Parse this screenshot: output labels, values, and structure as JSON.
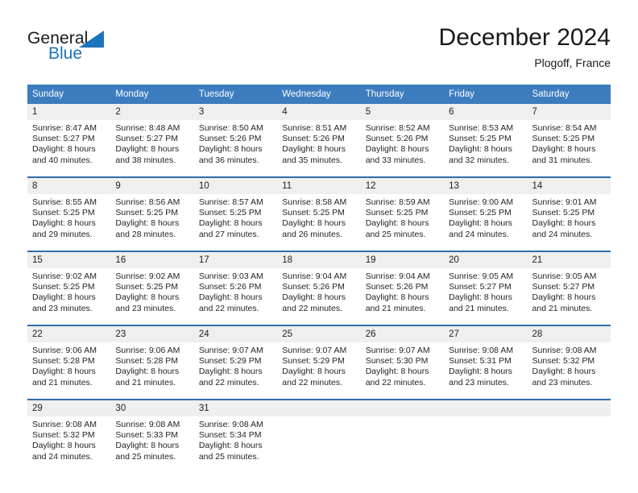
{
  "brand": {
    "name_top": "General",
    "name_bottom": "Blue",
    "accent_color": "#1c74bc",
    "triangle_icon": "brand-triangle-icon"
  },
  "header": {
    "title": "December 2024",
    "subtitle": "Plogoff, France"
  },
  "theme": {
    "header_blue": "#3c7cbf",
    "row_divider_blue": "#2f6da9",
    "daynum_band": "#efefef"
  },
  "calendar": {
    "weekday_headers": [
      "Sunday",
      "Monday",
      "Tuesday",
      "Wednesday",
      "Thursday",
      "Friday",
      "Saturday"
    ],
    "weeks": [
      [
        {
          "day": "1",
          "sunrise": "Sunrise: 8:47 AM",
          "sunset": "Sunset: 5:27 PM",
          "daylight1": "Daylight: 8 hours",
          "daylight2": "and 40 minutes."
        },
        {
          "day": "2",
          "sunrise": "Sunrise: 8:48 AM",
          "sunset": "Sunset: 5:27 PM",
          "daylight1": "Daylight: 8 hours",
          "daylight2": "and 38 minutes."
        },
        {
          "day": "3",
          "sunrise": "Sunrise: 8:50 AM",
          "sunset": "Sunset: 5:26 PM",
          "daylight1": "Daylight: 8 hours",
          "daylight2": "and 36 minutes."
        },
        {
          "day": "4",
          "sunrise": "Sunrise: 8:51 AM",
          "sunset": "Sunset: 5:26 PM",
          "daylight1": "Daylight: 8 hours",
          "daylight2": "and 35 minutes."
        },
        {
          "day": "5",
          "sunrise": "Sunrise: 8:52 AM",
          "sunset": "Sunset: 5:26 PM",
          "daylight1": "Daylight: 8 hours",
          "daylight2": "and 33 minutes."
        },
        {
          "day": "6",
          "sunrise": "Sunrise: 8:53 AM",
          "sunset": "Sunset: 5:25 PM",
          "daylight1": "Daylight: 8 hours",
          "daylight2": "and 32 minutes."
        },
        {
          "day": "7",
          "sunrise": "Sunrise: 8:54 AM",
          "sunset": "Sunset: 5:25 PM",
          "daylight1": "Daylight: 8 hours",
          "daylight2": "and 31 minutes."
        }
      ],
      [
        {
          "day": "8",
          "sunrise": "Sunrise: 8:55 AM",
          "sunset": "Sunset: 5:25 PM",
          "daylight1": "Daylight: 8 hours",
          "daylight2": "and 29 minutes."
        },
        {
          "day": "9",
          "sunrise": "Sunrise: 8:56 AM",
          "sunset": "Sunset: 5:25 PM",
          "daylight1": "Daylight: 8 hours",
          "daylight2": "and 28 minutes."
        },
        {
          "day": "10",
          "sunrise": "Sunrise: 8:57 AM",
          "sunset": "Sunset: 5:25 PM",
          "daylight1": "Daylight: 8 hours",
          "daylight2": "and 27 minutes."
        },
        {
          "day": "11",
          "sunrise": "Sunrise: 8:58 AM",
          "sunset": "Sunset: 5:25 PM",
          "daylight1": "Daylight: 8 hours",
          "daylight2": "and 26 minutes."
        },
        {
          "day": "12",
          "sunrise": "Sunrise: 8:59 AM",
          "sunset": "Sunset: 5:25 PM",
          "daylight1": "Daylight: 8 hours",
          "daylight2": "and 25 minutes."
        },
        {
          "day": "13",
          "sunrise": "Sunrise: 9:00 AM",
          "sunset": "Sunset: 5:25 PM",
          "daylight1": "Daylight: 8 hours",
          "daylight2": "and 24 minutes."
        },
        {
          "day": "14",
          "sunrise": "Sunrise: 9:01 AM",
          "sunset": "Sunset: 5:25 PM",
          "daylight1": "Daylight: 8 hours",
          "daylight2": "and 24 minutes."
        }
      ],
      [
        {
          "day": "15",
          "sunrise": "Sunrise: 9:02 AM",
          "sunset": "Sunset: 5:25 PM",
          "daylight1": "Daylight: 8 hours",
          "daylight2": "and 23 minutes."
        },
        {
          "day": "16",
          "sunrise": "Sunrise: 9:02 AM",
          "sunset": "Sunset: 5:25 PM",
          "daylight1": "Daylight: 8 hours",
          "daylight2": "and 23 minutes."
        },
        {
          "day": "17",
          "sunrise": "Sunrise: 9:03 AM",
          "sunset": "Sunset: 5:26 PM",
          "daylight1": "Daylight: 8 hours",
          "daylight2": "and 22 minutes."
        },
        {
          "day": "18",
          "sunrise": "Sunrise: 9:04 AM",
          "sunset": "Sunset: 5:26 PM",
          "daylight1": "Daylight: 8 hours",
          "daylight2": "and 22 minutes."
        },
        {
          "day": "19",
          "sunrise": "Sunrise: 9:04 AM",
          "sunset": "Sunset: 5:26 PM",
          "daylight1": "Daylight: 8 hours",
          "daylight2": "and 21 minutes."
        },
        {
          "day": "20",
          "sunrise": "Sunrise: 9:05 AM",
          "sunset": "Sunset: 5:27 PM",
          "daylight1": "Daylight: 8 hours",
          "daylight2": "and 21 minutes."
        },
        {
          "day": "21",
          "sunrise": "Sunrise: 9:05 AM",
          "sunset": "Sunset: 5:27 PM",
          "daylight1": "Daylight: 8 hours",
          "daylight2": "and 21 minutes."
        }
      ],
      [
        {
          "day": "22",
          "sunrise": "Sunrise: 9:06 AM",
          "sunset": "Sunset: 5:28 PM",
          "daylight1": "Daylight: 8 hours",
          "daylight2": "and 21 minutes."
        },
        {
          "day": "23",
          "sunrise": "Sunrise: 9:06 AM",
          "sunset": "Sunset: 5:28 PM",
          "daylight1": "Daylight: 8 hours",
          "daylight2": "and 21 minutes."
        },
        {
          "day": "24",
          "sunrise": "Sunrise: 9:07 AM",
          "sunset": "Sunset: 5:29 PM",
          "daylight1": "Daylight: 8 hours",
          "daylight2": "and 22 minutes."
        },
        {
          "day": "25",
          "sunrise": "Sunrise: 9:07 AM",
          "sunset": "Sunset: 5:29 PM",
          "daylight1": "Daylight: 8 hours",
          "daylight2": "and 22 minutes."
        },
        {
          "day": "26",
          "sunrise": "Sunrise: 9:07 AM",
          "sunset": "Sunset: 5:30 PM",
          "daylight1": "Daylight: 8 hours",
          "daylight2": "and 22 minutes."
        },
        {
          "day": "27",
          "sunrise": "Sunrise: 9:08 AM",
          "sunset": "Sunset: 5:31 PM",
          "daylight1": "Daylight: 8 hours",
          "daylight2": "and 23 minutes."
        },
        {
          "day": "28",
          "sunrise": "Sunrise: 9:08 AM",
          "sunset": "Sunset: 5:32 PM",
          "daylight1": "Daylight: 8 hours",
          "daylight2": "and 23 minutes."
        }
      ],
      [
        {
          "day": "29",
          "sunrise": "Sunrise: 9:08 AM",
          "sunset": "Sunset: 5:32 PM",
          "daylight1": "Daylight: 8 hours",
          "daylight2": "and 24 minutes."
        },
        {
          "day": "30",
          "sunrise": "Sunrise: 9:08 AM",
          "sunset": "Sunset: 5:33 PM",
          "daylight1": "Daylight: 8 hours",
          "daylight2": "and 25 minutes."
        },
        {
          "day": "31",
          "sunrise": "Sunrise: 9:08 AM",
          "sunset": "Sunset: 5:34 PM",
          "daylight1": "Daylight: 8 hours",
          "daylight2": "and 25 minutes."
        },
        {
          "day": "",
          "sunrise": "",
          "sunset": "",
          "daylight1": "",
          "daylight2": ""
        },
        {
          "day": "",
          "sunrise": "",
          "sunset": "",
          "daylight1": "",
          "daylight2": ""
        },
        {
          "day": "",
          "sunrise": "",
          "sunset": "",
          "daylight1": "",
          "daylight2": ""
        },
        {
          "day": "",
          "sunrise": "",
          "sunset": "",
          "daylight1": "",
          "daylight2": ""
        }
      ]
    ]
  }
}
